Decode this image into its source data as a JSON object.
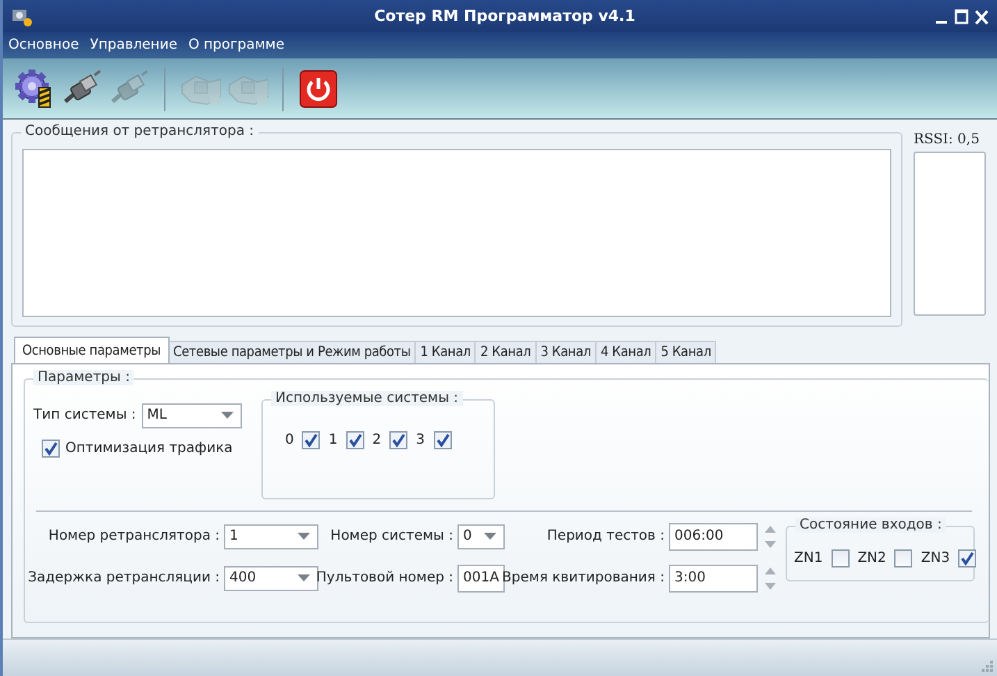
{
  "window": {
    "title": "Сотер RM Программатор v4.1"
  },
  "menu": [
    "Основное",
    "Управление",
    "О программе"
  ],
  "toolbar": [
    [
      {
        "kind": "gear",
        "disabled": false
      },
      {
        "kind": "plug",
        "disabled": false
      },
      {
        "kind": "plug",
        "disabled": true
      }
    ],
    [
      {
        "kind": "hands",
        "disabled": true
      },
      {
        "kind": "hands",
        "disabled": true
      }
    ],
    [
      {
        "kind": "power",
        "disabled": false
      }
    ]
  ],
  "messages": {
    "label": "Сообщения от ретранслятора :"
  },
  "rssi": {
    "label": "RSSI: 0,5"
  },
  "tabs": [
    {
      "label": "Основные параметры",
      "selected": true
    },
    {
      "label": "Сетевые параметры и Режим работы",
      "selected": false
    },
    {
      "label": "1 Канал",
      "selected": false
    },
    {
      "label": "2 Канал",
      "selected": false
    },
    {
      "label": "3 Канал",
      "selected": false
    },
    {
      "label": "4 Канал",
      "selected": false
    },
    {
      "label": "5 Канал",
      "selected": false
    }
  ],
  "params": {
    "label": "Параметры :",
    "system_type": {
      "label": "Тип системы :",
      "value": "ML"
    },
    "traffic_optimization": {
      "label": "Оптимизация трафика",
      "checked": true
    },
    "used_systems": {
      "label": "Используемые системы :",
      "items": [
        {
          "label": "0",
          "checked": true
        },
        {
          "label": "1",
          "checked": true
        },
        {
          "label": "2",
          "checked": true
        },
        {
          "label": "3",
          "checked": true
        }
      ]
    }
  },
  "field_rows": [
    [
      {
        "kind": "combo",
        "label": "Номер ретранслятора :",
        "value": "1"
      },
      {
        "kind": "combo",
        "label": "Номер системы :",
        "value": "0"
      },
      {
        "kind": "spin",
        "label": "Период тестов :",
        "value": "006:00"
      }
    ],
    [
      {
        "kind": "combo",
        "label": "Задержка ретрансляции :",
        "value": "400"
      },
      {
        "kind": "text",
        "label": "Пультовой номер :",
        "value": "001A"
      },
      {
        "kind": "spin",
        "label": "Время квитирования :",
        "value": "3:00"
      }
    ]
  ],
  "inputs_state": {
    "label": "Состояние входов :",
    "items": [
      {
        "label": "ZN1",
        "checked": false
      },
      {
        "label": "ZN2",
        "checked": false
      },
      {
        "label": "ZN3",
        "checked": true
      }
    ]
  }
}
